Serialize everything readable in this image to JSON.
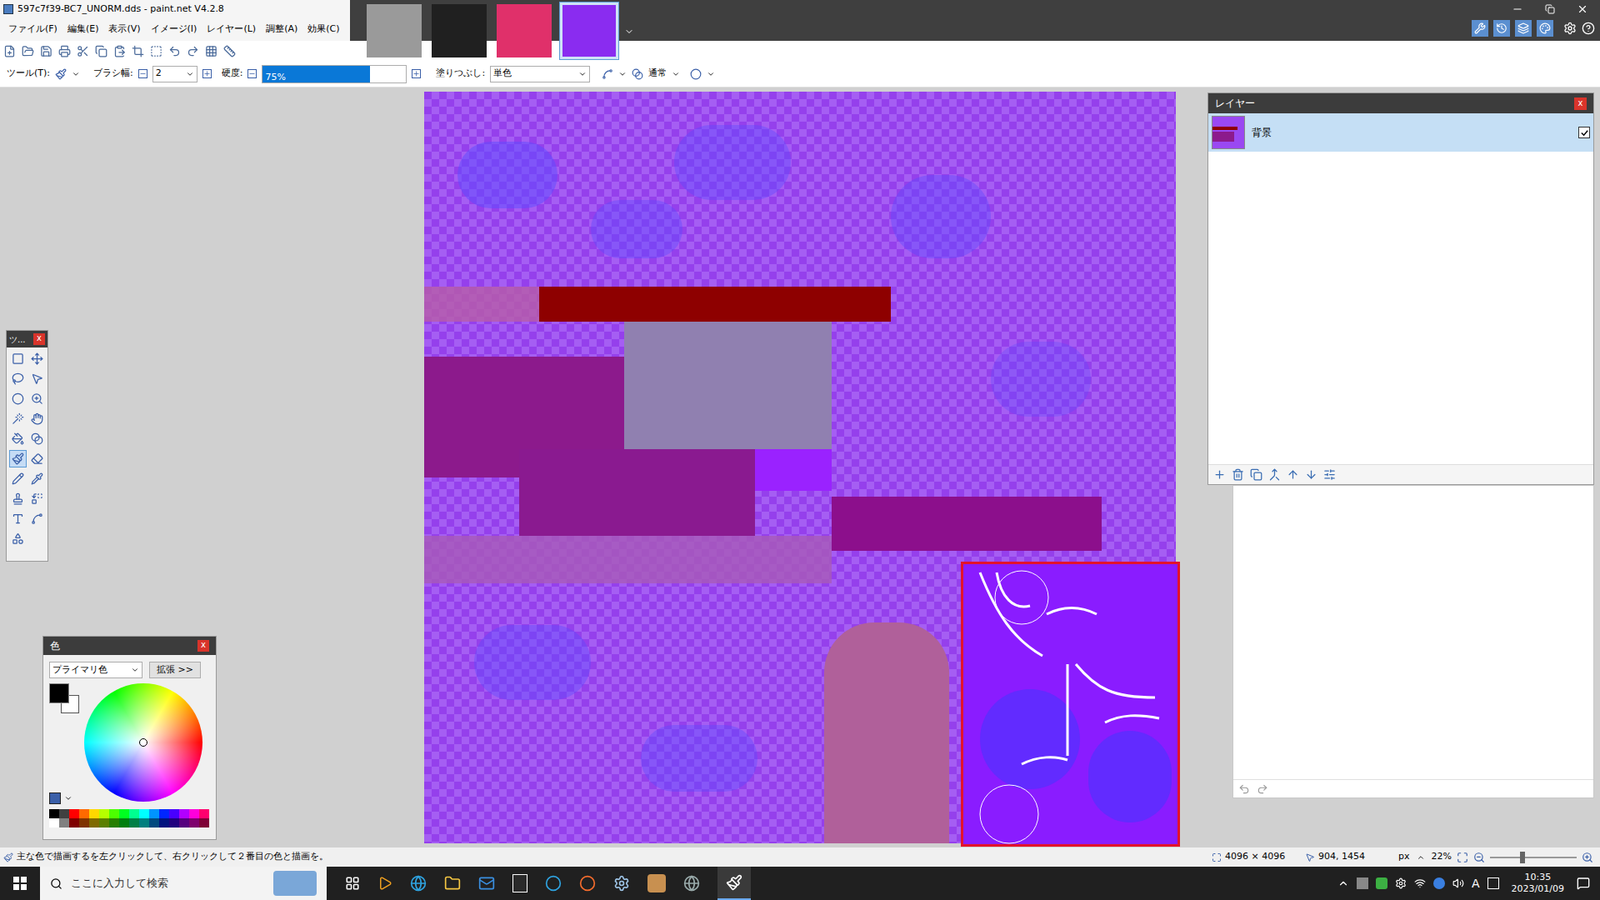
{
  "window": {
    "title": "597c7f39-BC7_UNORM.dds - paint.net V4.2.8"
  },
  "menu": [
    "ファイル(F)",
    "編集(E)",
    "表示(V)",
    "イメージ(I)",
    "レイヤー(L)",
    "調整(A)",
    "効果(C)"
  ],
  "image_tabs": [
    {
      "selected": false,
      "color": "#9a9a9a"
    },
    {
      "selected": false,
      "color": "#202020"
    },
    {
      "selected": false,
      "color": "#e0306a"
    },
    {
      "selected": true,
      "color": "#8a2cf0"
    }
  ],
  "tool_options": {
    "tool_label": "ツール(T):",
    "brush_width_label": "ブラシ幅:",
    "brush_width": "2",
    "hardness_label": "硬度:",
    "hardness": "75%",
    "hardness_level": 0.75,
    "fill_label": "塗りつぶし:",
    "fill": "単色",
    "blend_mode": "通常"
  },
  "tools_window": {
    "title": "ツ...",
    "close": "x",
    "tools": [
      {
        "selected": false
      },
      {
        "selected": false
      },
      {
        "selected": false
      },
      {
        "selected": false
      },
      {
        "selected": false
      },
      {
        "selected": false
      },
      {
        "selected": false
      },
      {
        "selected": false
      },
      {
        "selected": false
      },
      {
        "selected": false
      },
      {
        "selected": true
      },
      {
        "selected": false
      },
      {
        "selected": false
      },
      {
        "selected": false
      },
      {
        "selected": false
      },
      {
        "selected": false
      },
      {
        "selected": false
      },
      {
        "selected": false
      },
      {
        "selected": false
      }
    ]
  },
  "colors_window": {
    "title": "色",
    "close": "x",
    "mode": "プライマリ色",
    "more_button": "拡張 >>",
    "primary": "#000000",
    "secondary": "#ffffff",
    "palette": [
      "#000000",
      "#404040",
      "#ff0000",
      "#ff6a00",
      "#ffd800",
      "#b6ff00",
      "#4cff00",
      "#00ff21",
      "#00ff90",
      "#00ffff",
      "#0094ff",
      "#0026ff",
      "#4800ff",
      "#b200ff",
      "#ff00dc",
      "#ff006e",
      "#ffffff",
      "#808080",
      "#7f0000",
      "#7f3300",
      "#7f6a00",
      "#5b7f00",
      "#267f00",
      "#007f0e",
      "#007f46",
      "#007f7f",
      "#004a7f",
      "#00137f",
      "#21007f",
      "#57007f",
      "#7f006e",
      "#7f0037"
    ]
  },
  "layers_window": {
    "title": "レイヤー",
    "close": "x",
    "layers": [
      {
        "name": "背景",
        "visible": true,
        "selected": true
      }
    ]
  },
  "status_bar": {
    "hint": "主な色で描画するを左クリックして、右クリックして２番目の色と描画を。",
    "image_size": "4096 × 4096",
    "cursor": "904, 1454",
    "units": "px",
    "zoom": "22%",
    "zoom_level": 0.35
  },
  "taskbar": {
    "search_placeholder": "ここに入力して検索",
    "ime": "A",
    "time": "10:35",
    "date": "2023/01/09"
  }
}
